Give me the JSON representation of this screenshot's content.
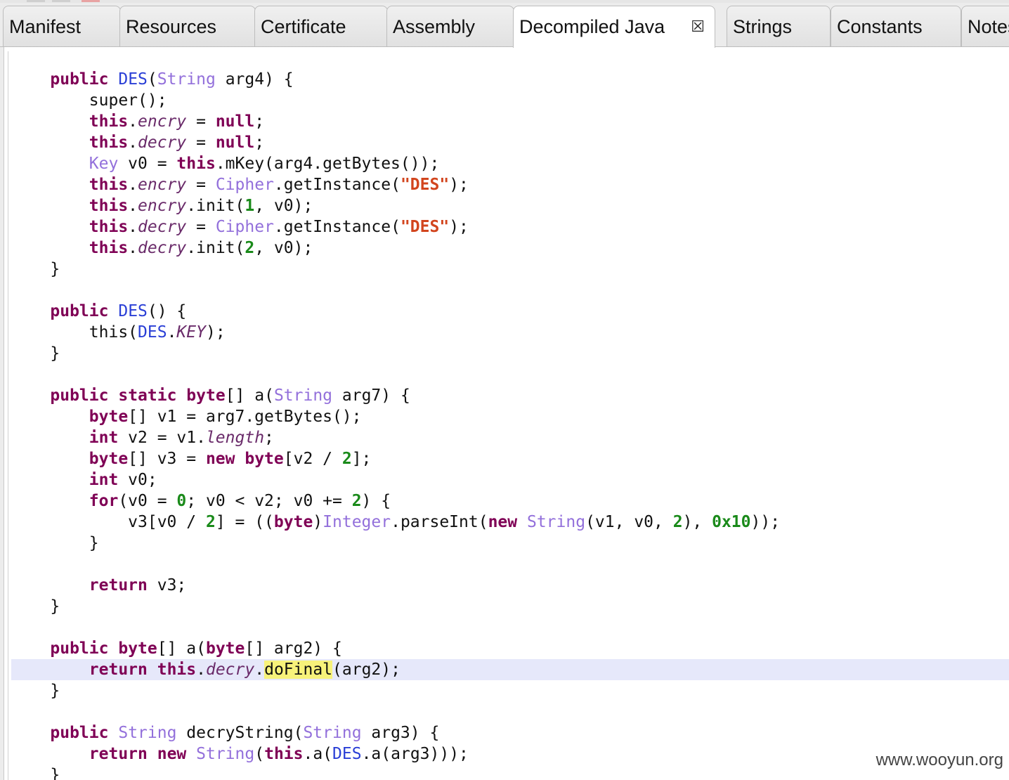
{
  "tabs": [
    {
      "label": "Manifest"
    },
    {
      "label": "Resources"
    },
    {
      "label": "Certificate"
    },
    {
      "label": "Assembly"
    },
    {
      "label": "Decompiled Java",
      "active": true,
      "close": "☒"
    },
    {
      "label": "Strings"
    },
    {
      "label": "Constants"
    },
    {
      "label": "Notes"
    }
  ],
  "colors": {
    "keyword": "#7f0055",
    "type": "#9370db",
    "class": "#2a3fd6",
    "string": "#d2451e",
    "number": "#1a8a1a",
    "highlight_line": "#e6e8fa",
    "search_mark": "#f7f27a"
  },
  "code_lines": [
    [
      {
        "t": "    "
      },
      {
        "c": "kw",
        "t": "public"
      },
      {
        "t": " "
      },
      {
        "c": "cls",
        "t": "DES"
      },
      {
        "t": "("
      },
      {
        "c": "type",
        "t": "String"
      },
      {
        "t": " arg4) {"
      }
    ],
    [
      {
        "t": "        super();"
      }
    ],
    [
      {
        "t": "        "
      },
      {
        "c": "kw",
        "t": "this"
      },
      {
        "t": "."
      },
      {
        "c": "fld",
        "t": "encry"
      },
      {
        "t": " = "
      },
      {
        "c": "kw",
        "t": "null"
      },
      {
        "t": ";"
      }
    ],
    [
      {
        "t": "        "
      },
      {
        "c": "kw",
        "t": "this"
      },
      {
        "t": "."
      },
      {
        "c": "fld",
        "t": "decry"
      },
      {
        "t": " = "
      },
      {
        "c": "kw",
        "t": "null"
      },
      {
        "t": ";"
      }
    ],
    [
      {
        "t": "        "
      },
      {
        "c": "type",
        "t": "Key"
      },
      {
        "t": " v0 = "
      },
      {
        "c": "kw",
        "t": "this"
      },
      {
        "t": ".mKey(arg4.getBytes());"
      }
    ],
    [
      {
        "t": "        "
      },
      {
        "c": "kw",
        "t": "this"
      },
      {
        "t": "."
      },
      {
        "c": "fld",
        "t": "encry"
      },
      {
        "t": " = "
      },
      {
        "c": "type",
        "t": "Cipher"
      },
      {
        "t": ".getInstance("
      },
      {
        "c": "str",
        "t": "\"DES\""
      },
      {
        "t": ");"
      }
    ],
    [
      {
        "t": "        "
      },
      {
        "c": "kw",
        "t": "this"
      },
      {
        "t": "."
      },
      {
        "c": "fld",
        "t": "encry"
      },
      {
        "t": ".init("
      },
      {
        "c": "num",
        "t": "1"
      },
      {
        "t": ", v0);"
      }
    ],
    [
      {
        "t": "        "
      },
      {
        "c": "kw",
        "t": "this"
      },
      {
        "t": "."
      },
      {
        "c": "fld",
        "t": "decry"
      },
      {
        "t": " = "
      },
      {
        "c": "type",
        "t": "Cipher"
      },
      {
        "t": ".getInstance("
      },
      {
        "c": "str",
        "t": "\"DES\""
      },
      {
        "t": ");"
      }
    ],
    [
      {
        "t": "        "
      },
      {
        "c": "kw",
        "t": "this"
      },
      {
        "t": "."
      },
      {
        "c": "fld",
        "t": "decry"
      },
      {
        "t": ".init("
      },
      {
        "c": "num",
        "t": "2"
      },
      {
        "t": ", v0);"
      }
    ],
    [
      {
        "t": "    }"
      }
    ],
    [],
    [
      {
        "t": "    "
      },
      {
        "c": "kw",
        "t": "public"
      },
      {
        "t": " "
      },
      {
        "c": "cls",
        "t": "DES"
      },
      {
        "t": "() {"
      }
    ],
    [
      {
        "t": "        this("
      },
      {
        "c": "cls",
        "t": "DES"
      },
      {
        "t": "."
      },
      {
        "c": "fld",
        "t": "KEY"
      },
      {
        "t": ");"
      }
    ],
    [
      {
        "t": "    }"
      }
    ],
    [],
    [
      {
        "t": "    "
      },
      {
        "c": "kw",
        "t": "public"
      },
      {
        "t": " "
      },
      {
        "c": "kw",
        "t": "static"
      },
      {
        "t": " "
      },
      {
        "c": "kw",
        "t": "byte"
      },
      {
        "t": "[] a("
      },
      {
        "c": "type",
        "t": "String"
      },
      {
        "t": " arg7) {"
      }
    ],
    [
      {
        "t": "        "
      },
      {
        "c": "kw",
        "t": "byte"
      },
      {
        "t": "[] v1 = arg7.getBytes();"
      }
    ],
    [
      {
        "t": "        "
      },
      {
        "c": "kw",
        "t": "int"
      },
      {
        "t": " v2 = v1."
      },
      {
        "c": "fld",
        "t": "length"
      },
      {
        "t": ";"
      }
    ],
    [
      {
        "t": "        "
      },
      {
        "c": "kw",
        "t": "byte"
      },
      {
        "t": "[] v3 = "
      },
      {
        "c": "kw",
        "t": "new"
      },
      {
        "t": " "
      },
      {
        "c": "kw",
        "t": "byte"
      },
      {
        "t": "[v2 / "
      },
      {
        "c": "num",
        "t": "2"
      },
      {
        "t": "];"
      }
    ],
    [
      {
        "t": "        "
      },
      {
        "c": "kw",
        "t": "int"
      },
      {
        "t": " v0;"
      }
    ],
    [
      {
        "t": "        "
      },
      {
        "c": "kw",
        "t": "for"
      },
      {
        "t": "(v0 = "
      },
      {
        "c": "num",
        "t": "0"
      },
      {
        "t": "; v0 < v2; v0 += "
      },
      {
        "c": "num",
        "t": "2"
      },
      {
        "t": ") {"
      }
    ],
    [
      {
        "t": "            v3[v0 / "
      },
      {
        "c": "num",
        "t": "2"
      },
      {
        "t": "] = (("
      },
      {
        "c": "kw",
        "t": "byte"
      },
      {
        "t": ")"
      },
      {
        "c": "type",
        "t": "Integer"
      },
      {
        "t": ".parseInt("
      },
      {
        "c": "kw",
        "t": "new"
      },
      {
        "t": " "
      },
      {
        "c": "type",
        "t": "String"
      },
      {
        "t": "(v1, v0, "
      },
      {
        "c": "num",
        "t": "2"
      },
      {
        "t": "), "
      },
      {
        "c": "num",
        "t": "0x10"
      },
      {
        "t": "));"
      }
    ],
    [
      {
        "t": "        }"
      }
    ],
    [],
    [
      {
        "t": "        "
      },
      {
        "c": "kw",
        "t": "return"
      },
      {
        "t": " v3;"
      }
    ],
    [
      {
        "t": "    }"
      }
    ],
    [],
    [
      {
        "t": "    "
      },
      {
        "c": "kw",
        "t": "public"
      },
      {
        "t": " "
      },
      {
        "c": "kw",
        "t": "byte"
      },
      {
        "t": "[] a("
      },
      {
        "c": "kw",
        "t": "byte"
      },
      {
        "t": "[] arg2) {"
      }
    ],
    [
      {
        "t": "        "
      },
      {
        "c": "kw",
        "t": "return"
      },
      {
        "t": " "
      },
      {
        "c": "kw",
        "t": "this"
      },
      {
        "t": "."
      },
      {
        "c": "fld",
        "t": "decry"
      },
      {
        "t": "."
      },
      {
        "c": "mark",
        "t": "doFinal"
      },
      {
        "t": "(arg2);"
      }
    ],
    [
      {
        "t": "    }"
      }
    ],
    [],
    [
      {
        "t": "    "
      },
      {
        "c": "kw",
        "t": "public"
      },
      {
        "t": " "
      },
      {
        "c": "type",
        "t": "String"
      },
      {
        "t": " decryString("
      },
      {
        "c": "type",
        "t": "String"
      },
      {
        "t": " arg3) {"
      }
    ],
    [
      {
        "t": "        "
      },
      {
        "c": "kw",
        "t": "return"
      },
      {
        "t": " "
      },
      {
        "c": "kw",
        "t": "new"
      },
      {
        "t": " "
      },
      {
        "c": "type",
        "t": "String"
      },
      {
        "t": "("
      },
      {
        "c": "kw",
        "t": "this"
      },
      {
        "t": ".a("
      },
      {
        "c": "cls",
        "t": "DES"
      },
      {
        "t": ".a(arg3)));"
      }
    ],
    [
      {
        "t": "    }"
      }
    ]
  ],
  "highlighted_line": 28,
  "watermark": "www.wooyun.org"
}
